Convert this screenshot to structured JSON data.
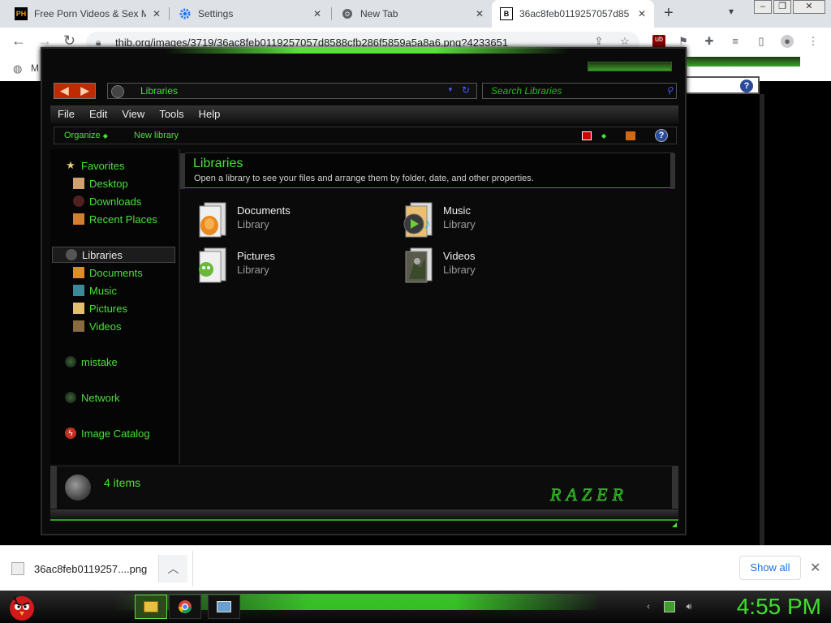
{
  "browser": {
    "tabs": [
      {
        "title": "Free Porn Videos & Sex M",
        "favicon": "PH"
      },
      {
        "title": "Settings",
        "favicon": "gear"
      },
      {
        "title": "New Tab",
        "favicon": "chrome"
      },
      {
        "title": "36ac8feb0119257057d85",
        "favicon": "B"
      }
    ],
    "url": "thib.org/images/3719/36ac8feb0119257057d8588cfb286f5859a5a8a6.png?4233651",
    "bookmark_initial": "M"
  },
  "explorer": {
    "address": "Libraries",
    "search_placeholder": "Search Libraries",
    "menu": [
      "File",
      "Edit",
      "View",
      "Tools",
      "Help"
    ],
    "commands": {
      "organize": "Organize",
      "new_library": "New library"
    },
    "nav": {
      "favorites": "Favorites",
      "favorites_items": [
        "Desktop",
        "Downloads",
        "Recent Places"
      ],
      "libraries": "Libraries",
      "libraries_items": [
        "Documents",
        "Music",
        "Pictures",
        "Videos"
      ],
      "other": [
        "mistake",
        "Network",
        "Image Catalog"
      ]
    },
    "header": {
      "title": "Libraries",
      "subtitle": "Open a library to see your files and arrange them by folder, date, and other properties."
    },
    "libraries": [
      {
        "name": "Documents",
        "type": "Library"
      },
      {
        "name": "Music",
        "type": "Library"
      },
      {
        "name": "Pictures",
        "type": "Library"
      },
      {
        "name": "Videos",
        "type": "Library"
      }
    ],
    "details": {
      "count": "4 items",
      "logo_text": "RAZER"
    }
  },
  "downloads": {
    "file": "36ac8feb0119257....png",
    "show_all": "Show all"
  },
  "taskbar": {
    "clock": "4:55 PM"
  },
  "colors": {
    "accent_green": "#4ae03a",
    "taskbar_clock": "#3ce02a",
    "download_link": "#1a73e8"
  }
}
